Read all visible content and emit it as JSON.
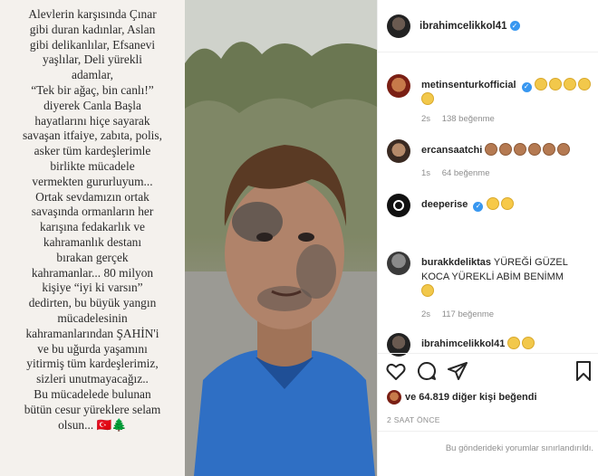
{
  "caption": {
    "text": "Alevlerin karşısında Çınar\ngibi duran kadınlar, Aslan\ngibi delikanlılar, Efsanevi\nyaşlılar, Deli yürekli\nadamlar,\n“Tek bir ağaç, bin canlı!”\ndiyerek Canla Başla\nhayatlarını hiçe sayarak\nsavaşan itfaiye, zabıta, polis,\nasker tüm kardeşlerimle\nbirlikte mücadele\nvermekten gururluyum...\nOrtak sevdamızın ortak\nsavaşında ormanların her\nkarışına fedakarlık ve\nkahramanlık destanı\nbırakan gerçek\nkahramanlar... 80 milyon\nkişiye “iyi ki varsın”\ndedirten, bu büyük yangın\nmücadelesinin\nkahramanlarından ŞAHİN'i\nve bu uğurda yaşamını\nyitirmiş tüm kardeşlerimiz,\nsizleri unutmayacağız..\nBu mücadelede bulunan\nbütün cesur yüreklere selam\nolsun... 🇹🇷🌲"
  },
  "post": {
    "username": "ibrahimcelikkol41",
    "likes_text": "ve 64.819 diğer kişi beğendi",
    "time": "2 SAAT ÖNCE",
    "restricted_text": "Bu gönderideki yorumlar sınırlandırıldı."
  },
  "comments": [
    {
      "username": "metinsenturkofficial",
      "verified": true,
      "text": "",
      "emoji_count": 5,
      "emoji_style": "clap",
      "time": "2s",
      "likes": "138 beğenme"
    },
    {
      "username": "ercansaatchi",
      "verified": false,
      "text": "",
      "emoji_count": 6,
      "emoji_style": "clap-brown",
      "time": "1s",
      "likes": "64 beğenme"
    },
    {
      "username": "deeperise",
      "verified": true,
      "text": "",
      "emoji_count": 2,
      "emoji_style": "face",
      "time": "",
      "likes": ""
    },
    {
      "username": "burakkdeliktas",
      "verified": false,
      "text": "YÜREĞİ GÜZEL KOCA YÜREKLİ ABİM BENİMM",
      "emoji_count": 1,
      "emoji_style": "clap",
      "time": "2s",
      "likes": "117 beğenme"
    },
    {
      "username": "ibrahimcelikkol41",
      "verified": false,
      "text": "",
      "emoji_count": 2,
      "emoji_style": "pray",
      "time": "",
      "likes": ""
    }
  ],
  "colors": {
    "verified_blue": "#3897f0",
    "caption_bg": "#f4f1ed",
    "meta_gray": "#8e8e8e"
  },
  "icons": [
    "heart-icon",
    "comment-icon",
    "share-icon",
    "bookmark-icon",
    "verified-icon"
  ]
}
